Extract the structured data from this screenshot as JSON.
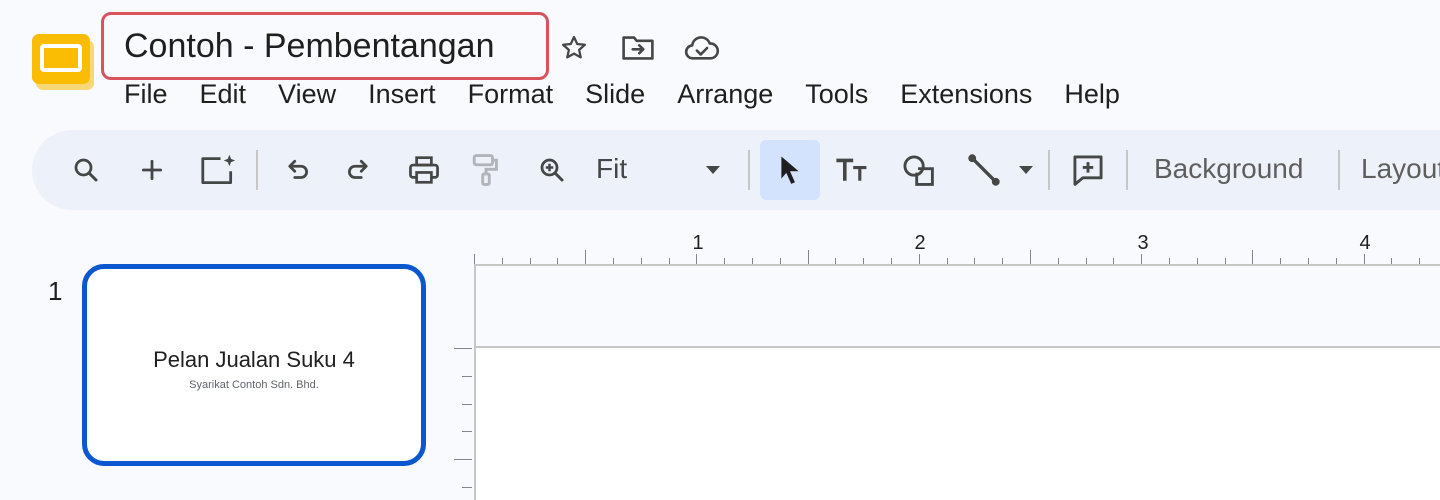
{
  "document": {
    "title": "Contoh - Pembentangan"
  },
  "title_icons": [
    "star-icon",
    "move-to-folder-icon",
    "cloud-saved-icon"
  ],
  "menu": [
    "File",
    "Edit",
    "View",
    "Insert",
    "Format",
    "Slide",
    "Arrange",
    "Tools",
    "Extensions",
    "Help"
  ],
  "toolbar": {
    "zoom_value": "Fit",
    "background_label": "Background",
    "layout_label": "Layout",
    "icons": [
      "search-icon",
      "new-slide-icon",
      "ai-image-icon",
      "undo-icon",
      "redo-icon",
      "print-icon",
      "paint-format-icon",
      "zoom-icon",
      "select-icon",
      "text-box-icon",
      "shape-icon",
      "line-icon",
      "comment-icon"
    ]
  },
  "ruler": {
    "marks": [
      "1",
      "2",
      "3",
      "4"
    ]
  },
  "filmstrip": {
    "slides": [
      {
        "number": "1",
        "title": "Pelan Jualan Suku 4",
        "subtitle": "Syarikat Contoh Sdn. Bhd."
      }
    ]
  },
  "colors": {
    "accent": "#0b57d0",
    "title_highlight": "#d9535f",
    "toolbar_bg": "#edf2fa",
    "active_tool_bg": "#d3e3fd",
    "logo": "#fbbc04"
  }
}
